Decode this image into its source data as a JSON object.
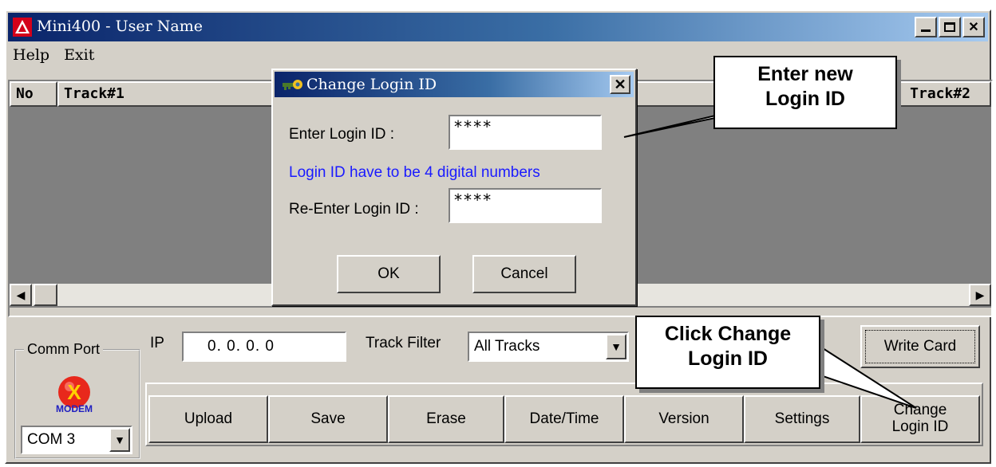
{
  "window": {
    "title": "Mini400  -  User Name",
    "controls": {
      "minimize_icon": "minimize-icon",
      "maximize_icon": "maximize-icon",
      "close_glyph": "✕"
    }
  },
  "menu": [
    {
      "label": "Help"
    },
    {
      "label": "Exit"
    }
  ],
  "listview": {
    "columns": [
      "No",
      "Track#1",
      "Track#2"
    ],
    "scroll_left": "◀",
    "scroll_right": "▶"
  },
  "comm_port": {
    "legend": "Comm Port",
    "status_icon": "modem-disconnected-icon",
    "modem_label": "MODEM",
    "port_value": "COM 3",
    "dropdown_glyph": "▼"
  },
  "ip": {
    "label": "IP",
    "value": "0.  0.  0.  0"
  },
  "track_filter": {
    "label": "Track Filter",
    "value": "All Tracks",
    "dropdown_glyph": "▼"
  },
  "buttons": {
    "write_card": "Write Card",
    "upload": "Upload",
    "save": "Save",
    "erase": "Erase",
    "date_time": "Date/Time",
    "version": "Version",
    "settings": "Settings",
    "change_login_line1": "Change",
    "change_login_line2": "Login ID"
  },
  "dialog": {
    "title": "Change Login ID",
    "icon": "key-icon",
    "close_glyph": "✕",
    "enter_label": "Enter Login ID :",
    "enter_value": "****",
    "hint": "Login ID have to be 4 digital numbers",
    "reenter_label": "Re-Enter Login ID :",
    "reenter_value": "****",
    "ok_label": "OK",
    "cancel_label": "Cancel"
  },
  "callouts": {
    "enter_new_line1": "Enter new",
    "enter_new_line2": "Login ID",
    "click_change_line1": "Click Change",
    "click_change_line2": "Login ID"
  },
  "colors": {
    "title_active": "#0a246a",
    "face": "#d4d0c8",
    "list_bg": "#808080",
    "hint_text": "#1a1aff",
    "modem_red": "#e8281c"
  }
}
